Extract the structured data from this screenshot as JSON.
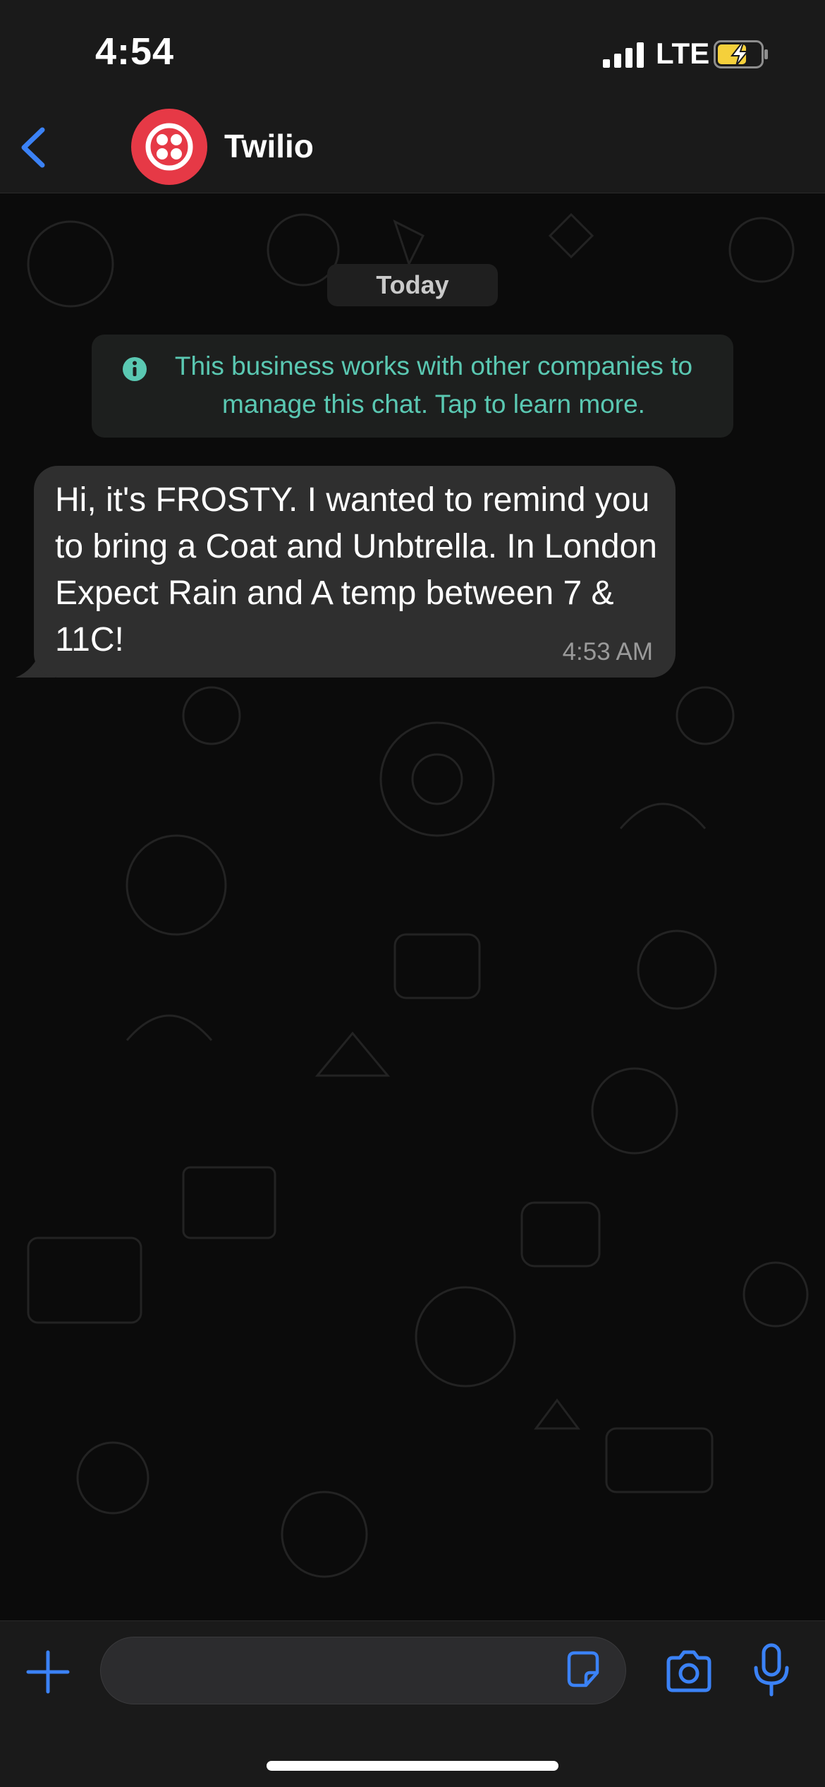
{
  "status_bar": {
    "time": "4:54",
    "network": "LTE"
  },
  "header": {
    "contact_name": "Twilio"
  },
  "chat": {
    "date_label": "Today",
    "system_notice": "This business works with other companies to manage this chat. Tap to learn more.",
    "messages": [
      {
        "text": "Hi, it's FROSTY. I wanted to remind you to bring a Coat and Unbtrella. In London Expect Rain and A temp between 7 & 11C!",
        "time": "4:53 AM",
        "direction": "incoming"
      }
    ]
  },
  "input_bar": {
    "value": ""
  },
  "colors": {
    "accent": "#3b82f6",
    "notice_text": "#5ac8b2",
    "avatar_bg": "#e63946",
    "bubble_bg": "#2f2f2f",
    "bar_bg": "#1a1a1a",
    "battery_fill": "#f5d03b"
  },
  "icons": [
    "back-chevron-icon",
    "twilio-logo-icon",
    "info-icon",
    "plus-icon",
    "sticker-icon",
    "camera-icon",
    "microphone-icon",
    "signal-icon",
    "battery-charging-icon"
  ]
}
